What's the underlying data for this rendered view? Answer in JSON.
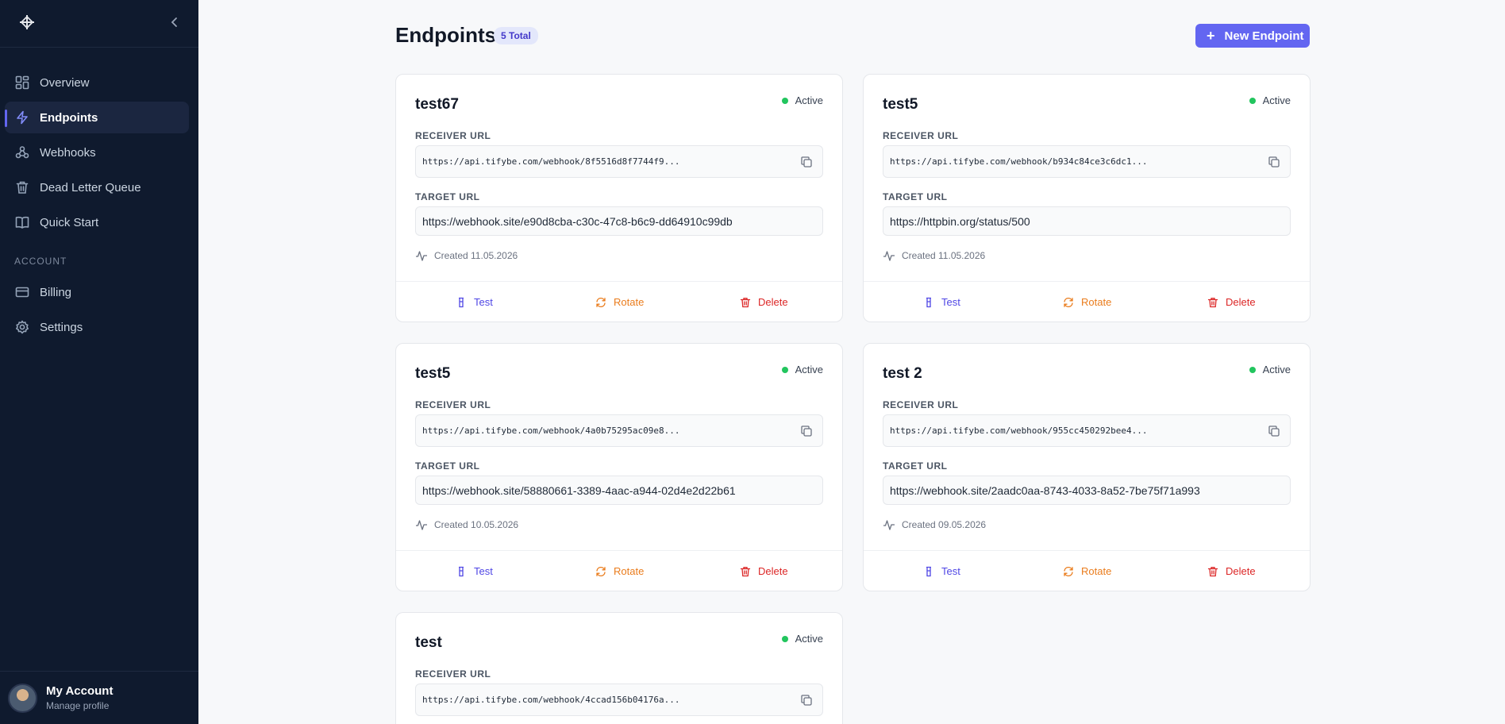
{
  "colors": {
    "accent": "#6366f1",
    "sidebar_bg": "#0f1a2e",
    "active": "#22c55e",
    "rotate": "#ea7c1c",
    "delete": "#dc2626"
  },
  "sidebar": {
    "nav": [
      {
        "label": "Overview",
        "icon": "grid-icon"
      },
      {
        "label": "Endpoints",
        "icon": "zap-icon",
        "active": true
      },
      {
        "label": "Webhooks",
        "icon": "webhook-icon"
      },
      {
        "label": "Dead Letter Queue",
        "icon": "trash-icon"
      },
      {
        "label": "Quick Start",
        "icon": "book-icon"
      }
    ],
    "section_account": "ACCOUNT",
    "account_nav": [
      {
        "label": "Billing",
        "icon": "credit-card-icon"
      },
      {
        "label": "Settings",
        "icon": "gear-icon"
      }
    ],
    "account": {
      "name": "My Account",
      "sub": "Manage profile"
    }
  },
  "header": {
    "title": "Endpoints",
    "total": "5 Total",
    "new_button": "New Endpoint"
  },
  "labels": {
    "receiver": "RECEIVER URL",
    "target": "TARGET URL",
    "test": "Test",
    "rotate": "Rotate",
    "delete": "Delete"
  },
  "endpoints": [
    {
      "name": "test67",
      "status": "Active",
      "receiver": "https://api.tifybe.com/webhook/8f5516d8f7744f9...",
      "target": "https://webhook.site/e90d8cba-c30c-47c8-b6c9-dd64910c99db",
      "created": "Created 11.05.2026"
    },
    {
      "name": "test5",
      "status": "Active",
      "receiver": "https://api.tifybe.com/webhook/b934c84ce3c6dc1...",
      "target": "https://httpbin.org/status/500",
      "created": "Created 11.05.2026"
    },
    {
      "name": "test5",
      "status": "Active",
      "receiver": "https://api.tifybe.com/webhook/4a0b75295ac09e8...",
      "target": "https://webhook.site/58880661-3389-4aac-a944-02d4e2d22b61",
      "created": "Created 10.05.2026"
    },
    {
      "name": "test 2",
      "status": "Active",
      "receiver": "https://api.tifybe.com/webhook/955cc450292bee4...",
      "target": "https://webhook.site/2aadc0aa-8743-4033-8a52-7be75f71a993",
      "created": "Created 09.05.2026"
    },
    {
      "name": "test",
      "status": "Active",
      "receiver": "https://api.tifybe.com/webhook/4ccad156b04176a..."
    }
  ]
}
